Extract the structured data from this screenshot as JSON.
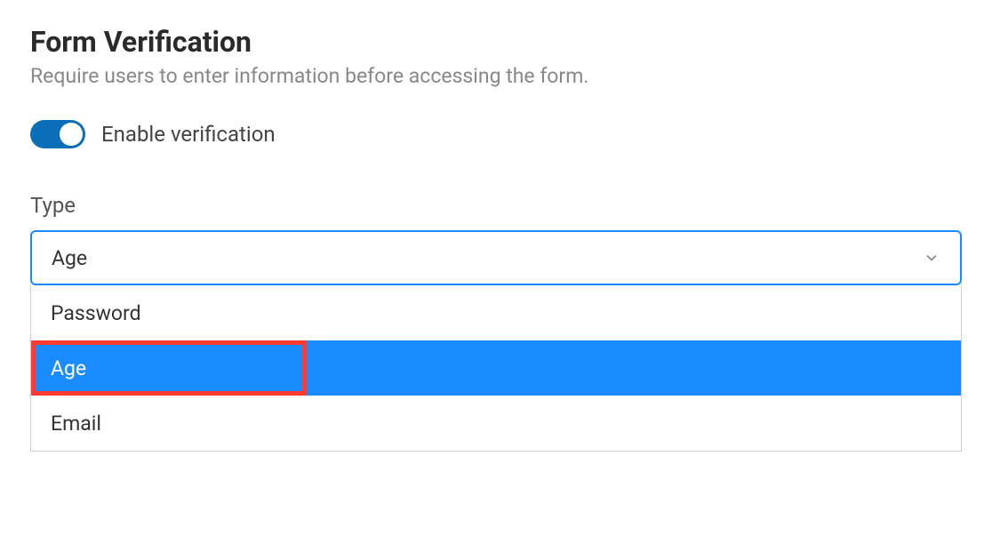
{
  "title": "Form Verification",
  "subtitle": "Require users to enter information before accessing the form.",
  "toggle": {
    "label": "Enable verification",
    "enabled": true
  },
  "type_field": {
    "label": "Type",
    "selected": "Age",
    "options": [
      "Password",
      "Age",
      "Email"
    ],
    "highlighted_option": "Age"
  }
}
